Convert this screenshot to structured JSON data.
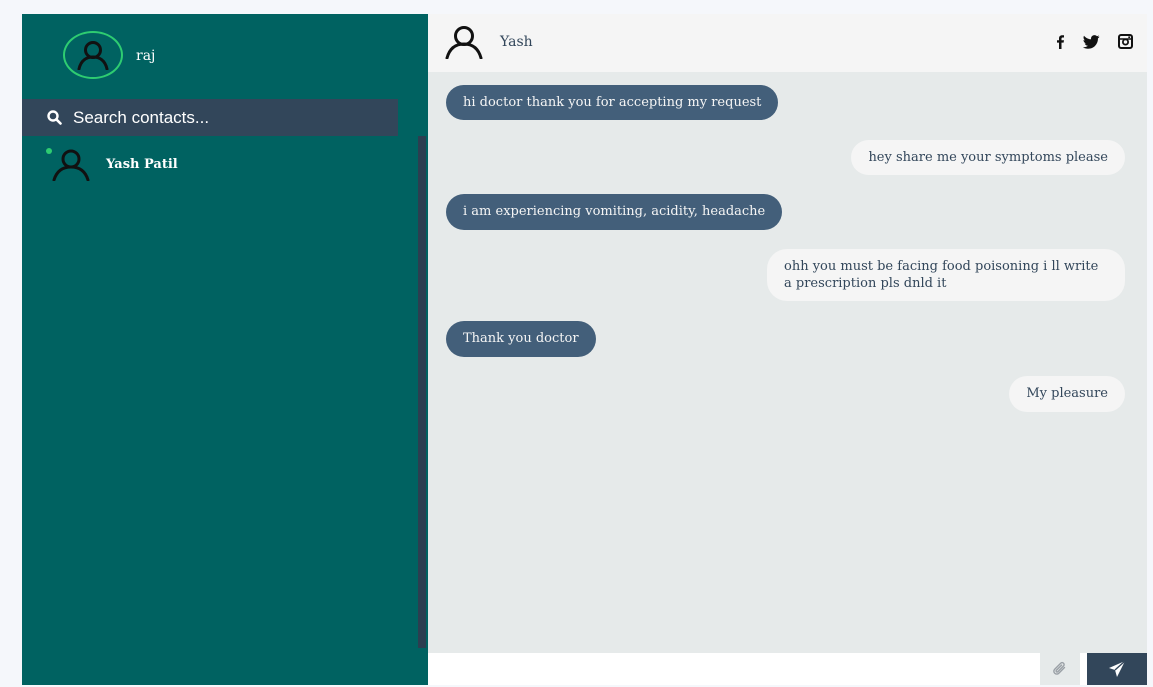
{
  "profile": {
    "name": "raj"
  },
  "search": {
    "placeholder": "Search contacts..."
  },
  "contacts": [
    {
      "name": "Yash Patil",
      "status": "online"
    }
  ],
  "chat": {
    "contact_name": "Yash",
    "social_icons": [
      "facebook-icon",
      "twitter-icon",
      "instagram-icon"
    ],
    "messages": [
      {
        "type": "sent",
        "text": "hi doctor thank you for accepting my request"
      },
      {
        "type": "replied",
        "text": "hey share me your symptoms please"
      },
      {
        "type": "sent",
        "text": "i am experiencing vomiting, acidity, headache"
      },
      {
        "type": "replied",
        "text": "ohh you must be facing food poisoning i ll write a prescription pls dnld it"
      },
      {
        "type": "sent",
        "text": "Thank you doctor"
      },
      {
        "type": "replied",
        "text": "My pleasure"
      }
    ]
  },
  "composer": {
    "value": "",
    "attach_icon": "paperclip-icon",
    "send_icon": "paper-plane-icon"
  },
  "colors": {
    "sidebar": "#006261",
    "search_bar": "#32465a",
    "sent_bubble": "#435f7a",
    "replied_bubble": "#f5f5f5",
    "chat_background": "#e6eaea",
    "online_status": "#2ecc71"
  }
}
